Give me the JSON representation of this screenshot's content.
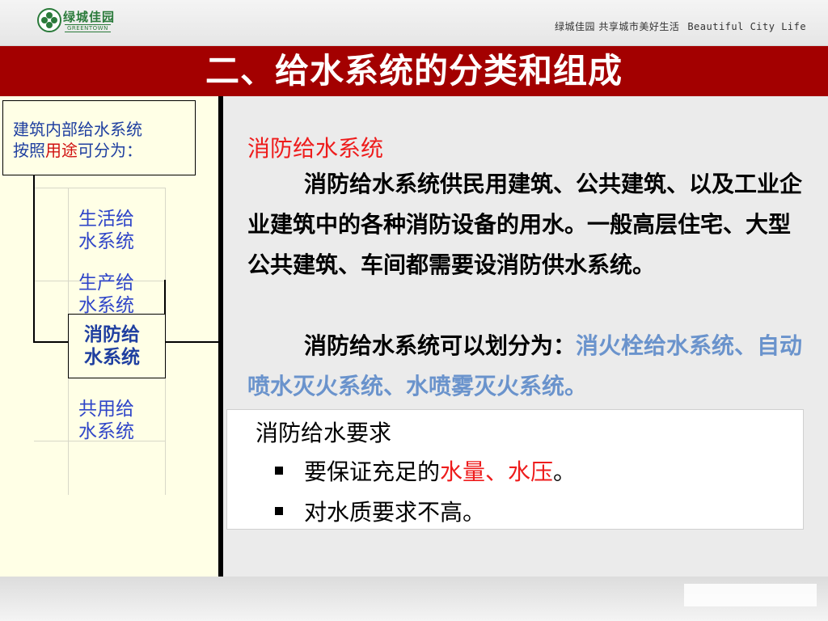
{
  "header": {
    "logo_cn": "绿城佳园",
    "logo_en": "GREENTOWN",
    "slogan_cn": "绿城佳园  共享城市美好生活",
    "slogan_en": "Beautiful City Life"
  },
  "title": "二、给水系统的分类和组成",
  "left_panel": {
    "intro_line1": "建筑内部给水系统",
    "intro_line2_before": "按照",
    "intro_line2_em": "用途",
    "intro_line2_after": "可分为：",
    "categories": [
      {
        "line1": "生活给",
        "line2": "水系统"
      },
      {
        "line1": "生产给",
        "line2": "水系统"
      },
      {
        "line1": "消防给",
        "line2": "水系统"
      },
      {
        "line1": "共用给",
        "line2": "水系统"
      }
    ]
  },
  "content": {
    "subtitle": "消防给水系统",
    "para1": "消防给水系统供民用建筑、公共建筑、以及工业企业建筑中的各种消防设备的用水。一般高层住宅、大型公共建筑、车间都需要设消防供水系统。",
    "para2_lead": "消防给水系统可以划分为：",
    "para2_blue": "消火栓给水系统、自动喷水灭火系统、水喷雾灭火系统。",
    "requirements": {
      "title": "消防给水要求",
      "item1_before": "要保证充足的",
      "item1_red": "水量、水压",
      "item1_after": "。",
      "item2": "对水质要求不高。"
    }
  },
  "colors": {
    "title_band": "#a30000",
    "highlight_red": "#ee1c1c",
    "highlight_blue": "#6a93cc",
    "category_blue": "#2f45c8",
    "left_panel_bg": "#ffffe6"
  }
}
